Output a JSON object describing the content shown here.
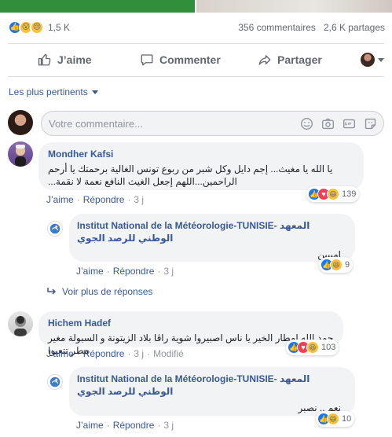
{
  "post_stats": {
    "reactions": [
      "like",
      "wow",
      "sad"
    ],
    "reaction_count": "1,5 K",
    "comments": "356 commentaires",
    "shares": "2,6 K partages"
  },
  "actions": {
    "like": "J’aime",
    "comment": "Commenter",
    "share": "Partager"
  },
  "sort": {
    "label": "Les plus pertinents"
  },
  "composer": {
    "placeholder": "Votre commentaire..."
  },
  "comments": [
    {
      "author": "Mondher Kafsi",
      "text": "يا الله يا مغيث... إجم دايل وكل شبر من ربوع تونس الغالية برحمتك يا أرحم الراحمين...اللهم إجعل الغيث النافع نعمة لا نقمة...",
      "like": "J’aime",
      "reply": "Répondre",
      "time": "3 j",
      "reactions": [
        "like",
        "love",
        "haha"
      ],
      "reaction_count": "139",
      "reply_item": {
        "author": "Institut National de la Météorologie-TUNISIE- المعهد الوطني للرصد الجوي",
        "text": "امييين",
        "like": "J’aime",
        "reply": "Répondre",
        "time": "3 j",
        "reactions": [
          "like",
          "haha"
        ],
        "reaction_count": "9"
      }
    },
    {
      "author": "Hichem Hadef",
      "text": "حمد الله امطار الخير يا ناس اصبيروا شوية راڤا بلاد الزيتونة و السبولة مغير مطر تتعبوا",
      "like": "J’aime",
      "reply": "Répondre",
      "time": "3 j",
      "modified": "Modifié",
      "reactions": [
        "like",
        "love",
        "haha"
      ],
      "reaction_count": "103",
      "reply_item": {
        "author": "Institut National de la Météorologie-TUNISIE- المعهد الوطني للرصد الجوي",
        "text": "نعم .. نصبر",
        "like": "J’aime",
        "reply": "Répondre",
        "time": "3 j",
        "reactions": [
          "like",
          "haha"
        ],
        "reaction_count": "10"
      }
    }
  ],
  "more_replies": "Voir plus de réponses",
  "colors": {
    "link": "#385898",
    "facebook_blue": "#1877f2",
    "bubble": "#f2f3f5"
  }
}
